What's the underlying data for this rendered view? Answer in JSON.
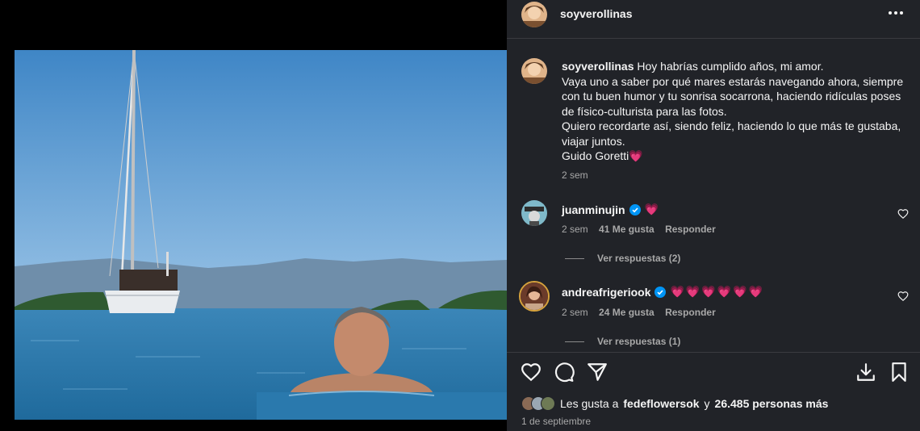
{
  "post": {
    "username": "soyverollinas",
    "more_icon": "more-horizontal-icon",
    "caption": {
      "username": "soyverollinas",
      "lines": [
        "Hoy habrías cumplido años, mi amor.",
        "Vaya uno a saber por qué mares estarás navegando ahora, siempre con tu buen humor y tu sonrisa socarrona, haciendo ridículas poses de físico-culturista para las fotos.",
        "Quiero recordarte así, siendo feliz, haciendo lo que más te gustaba, viajar juntos.",
        "Guido Goretti💗"
      ],
      "time": "2 sem"
    }
  },
  "comments": [
    {
      "username": "juanminujin",
      "verified": true,
      "text": "💗",
      "time": "2 sem",
      "likes": "41 Me gusta",
      "reply_label": "Responder",
      "view_replies": "Ver respuestas (2)"
    },
    {
      "username": "andreafrigeriook",
      "verified": true,
      "text": "💗💗💗💗💗💗",
      "time": "2 sem",
      "likes": "24 Me gusta",
      "reply_label": "Responder",
      "view_replies": "Ver respuestas (1)"
    }
  ],
  "actions": {
    "like_icon": "heart-icon",
    "comment_icon": "comment-icon",
    "share_icon": "send-icon",
    "download_icon": "download-icon",
    "save_icon": "bookmark-icon"
  },
  "likes": {
    "prefix": "Les gusta a",
    "user": "fedeflowersok",
    "connector": "y",
    "count": "26.485 personas más"
  },
  "date": "1 de septiembre",
  "colors": {
    "panel_bg": "#212328",
    "heart_pink": "#ff3d6e",
    "verified_blue": "#0095f6"
  }
}
